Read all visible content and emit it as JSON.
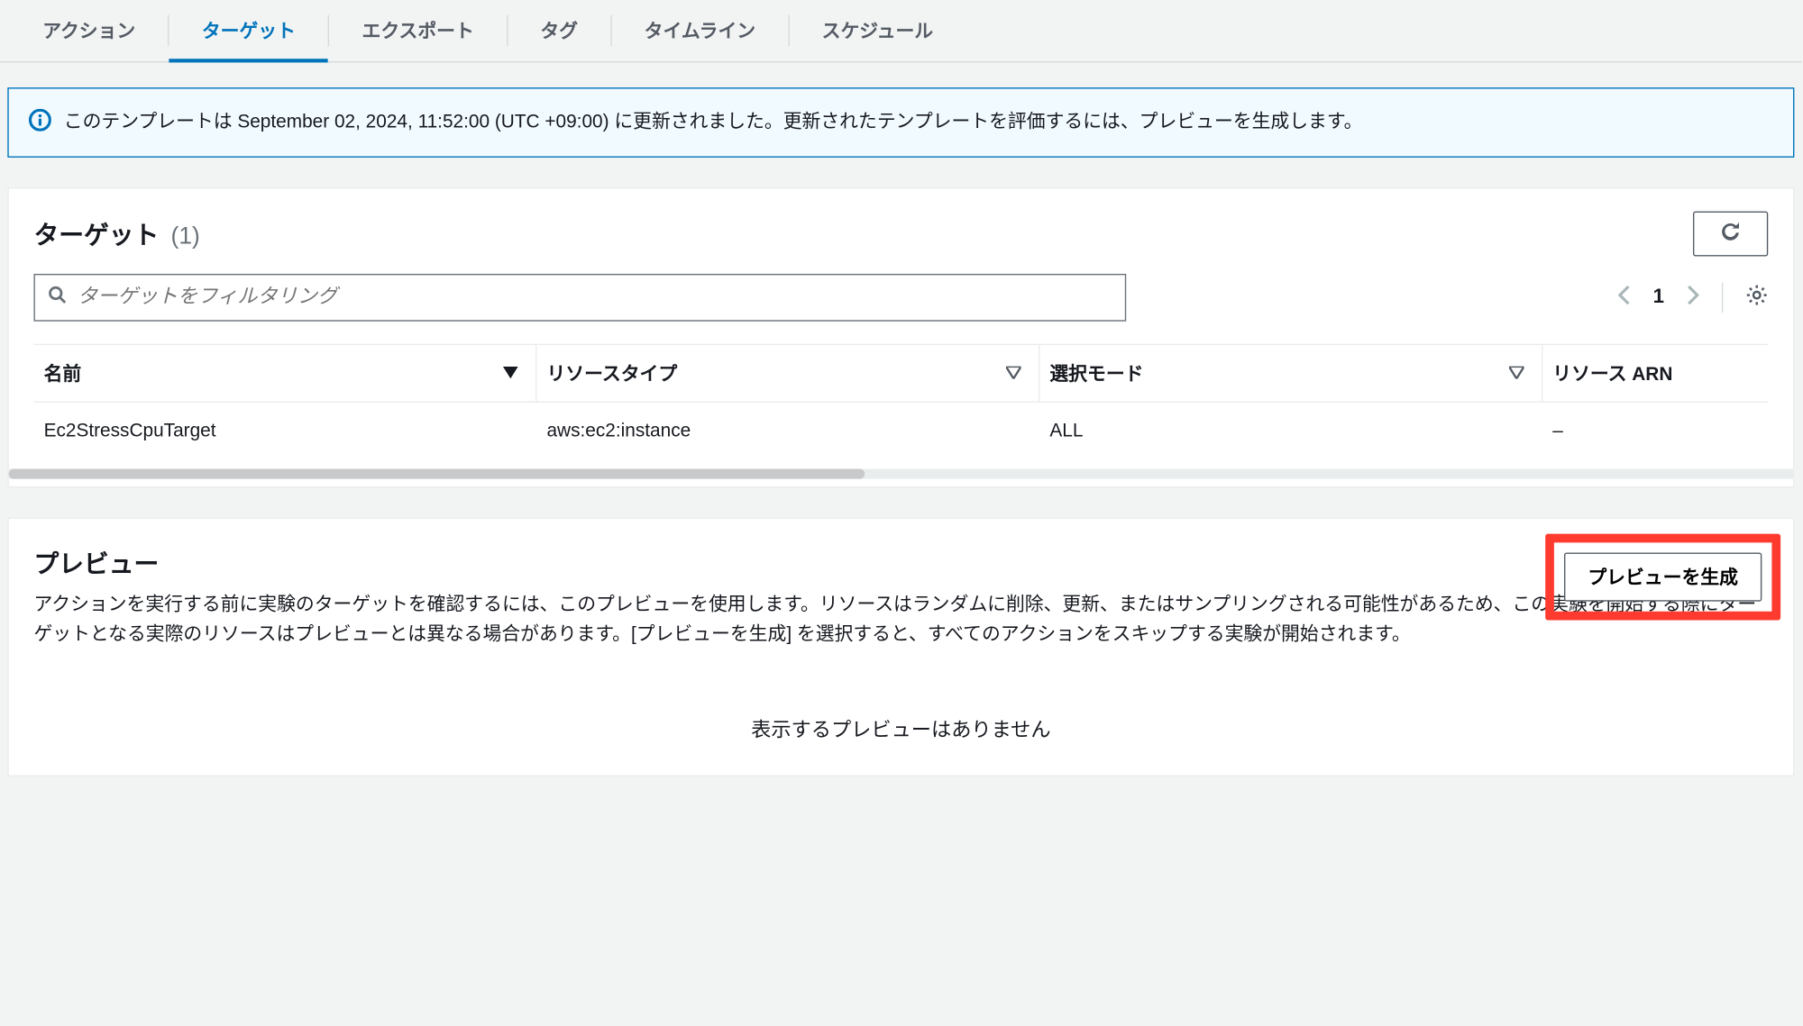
{
  "tabs": {
    "action": "アクション",
    "target": "ターゲット",
    "export": "エクスポート",
    "tag": "タグ",
    "timeline": "タイムライン",
    "schedule": "スケジュール"
  },
  "banner": {
    "text": "このテンプレートは September 02, 2024, 11:52:00 (UTC +09:00) に更新されました。更新されたテンプレートを評価するには、プレビューを生成します。"
  },
  "targets": {
    "title": "ターゲット",
    "count": "(1)",
    "filter_placeholder": "ターゲットをフィルタリング",
    "page": "1",
    "columns": {
      "name": "名前",
      "resource_type": "リソースタイプ",
      "selection_mode": "選択モード",
      "resource_arn": "リソース ARN"
    },
    "rows": [
      {
        "name": "Ec2StressCpuTarget",
        "resource_type": "aws:ec2:instance",
        "selection_mode": "ALL",
        "resource_arn": "–"
      }
    ]
  },
  "preview": {
    "title": "プレビュー",
    "generate_label": "プレビューを生成",
    "description": "アクションを実行する前に実験のターゲットを確認するには、このプレビューを使用します。リソースはランダムに削除、更新、またはサンプリングされる可能性があるため、この実験を開始する際にターゲットとなる実際のリソースはプレビューとは異なる場合があります。[プレビューを生成] を選択すると、すべてのアクションをスキップする実験が開始されます。",
    "empty": "表示するプレビューはありません"
  }
}
